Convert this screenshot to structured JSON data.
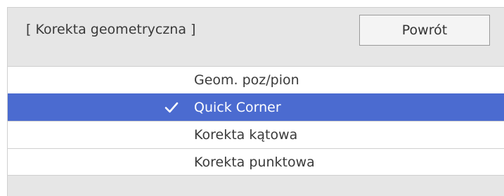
{
  "dialog": {
    "title": "[ Korekta geometryczna ]",
    "back_label": "Powrót"
  },
  "menu": {
    "items": [
      {
        "label": "Geom. poz/pion",
        "selected": false
      },
      {
        "label": "Quick Corner",
        "selected": true,
        "icon": "check-icon"
      },
      {
        "label": "Korekta kątowa",
        "selected": false
      },
      {
        "label": "Korekta punktowa",
        "selected": false
      }
    ]
  },
  "colors": {
    "selected_background": "#4b6bd0",
    "panel_background": "#e6e6e6",
    "item_background": "#ffffff"
  }
}
